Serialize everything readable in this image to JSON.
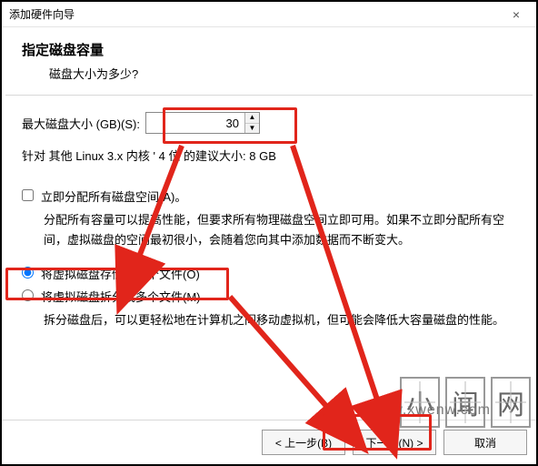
{
  "window": {
    "title": "添加硬件向导"
  },
  "header": {
    "title": "指定磁盘容量",
    "subtitle": "磁盘大小为多少?"
  },
  "size": {
    "label": "最大磁盘大小 (GB)(S):",
    "value": "30",
    "recommend": "针对 其他 Linux 3.x 内核 ' 4 位 的建议大小: 8 GB"
  },
  "allocateNow": {
    "label": "立即分配所有磁盘空间(A)。",
    "desc": "分配所有容量可以提高性能，但要求所有物理磁盘空间立即可用。如果不立即分配所有空间，虚拟磁盘的空间最初很小，会随着您向其中添加数据而不断变大。"
  },
  "storage": {
    "single": "将虚拟磁盘存储为单个文件(O)",
    "split": "将虚拟磁盘拆分成多个文件(M)",
    "splitDesc": "拆分磁盘后，可以更轻松地在计算机之间移动虚拟机，但可能会降低大容量磁盘的性能。"
  },
  "footer": {
    "back": "< 上一步(B)",
    "next": "下一步(N) >",
    "cancel": "取消"
  },
  "watermark": {
    "c1": "小",
    "c2": "闻",
    "c3": "网",
    "url": "www.xwenw.com"
  },
  "colors": {
    "highlight": "#e1251b"
  }
}
